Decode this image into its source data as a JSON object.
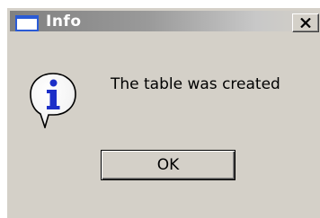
{
  "window": {
    "title": "Info",
    "icon": "window-icon"
  },
  "titlebar": {
    "close_icon": "close-icon"
  },
  "content": {
    "icon": "info-icon",
    "message": "The table was created"
  },
  "buttons": {
    "ok_label": "OK"
  },
  "colors": {
    "dialog_background": "#d4d0c8",
    "titlebar_inactive": "#808080",
    "info_icon_blue": "#1c2fc8"
  }
}
